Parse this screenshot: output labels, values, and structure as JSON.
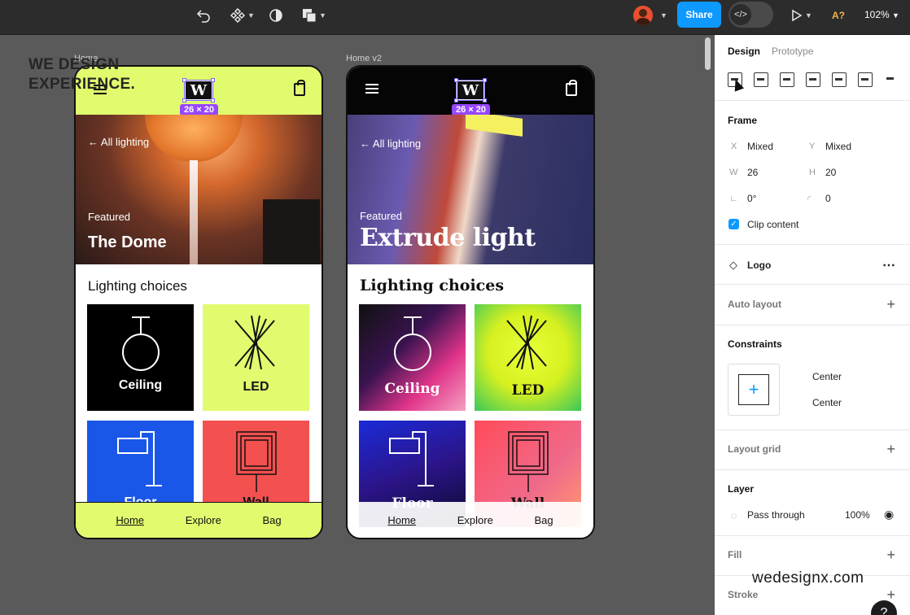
{
  "toolbar": {
    "share_label": "Share",
    "zoom": "102%",
    "a_label": "A?",
    "dev_icon": "</>"
  },
  "canvas": {
    "frame1_label": "Home",
    "frame2_label": "Home v2",
    "watermark_top_line1": "WE DESIGN",
    "watermark_top_line2": "EXPERIENCE.",
    "watermark_bottom": "wedesignx.com"
  },
  "phone1": {
    "size_badge": "26 × 20",
    "back_link": "← All lighting",
    "featured": "Featured",
    "hero_title": "The Dome",
    "section_title": "Lighting choices",
    "tiles": [
      "Ceiling",
      "LED",
      "Floor",
      "Wall"
    ],
    "nav": [
      "Home",
      "Explore",
      "Bag"
    ]
  },
  "phone2": {
    "size_badge": "26 × 20",
    "back_link": "← All lighting",
    "featured": "Featured",
    "hero_title": "Extrude light",
    "section_title": "Lighting choices",
    "tiles": [
      "Ceiling",
      "LED",
      "Floor",
      "Wall"
    ],
    "nav": [
      "Home",
      "Explore",
      "Bag"
    ]
  },
  "panel": {
    "tab_design": "Design",
    "tab_prototype": "Prototype",
    "frame_title": "Frame",
    "x_key": "X",
    "x_val": "Mixed",
    "y_key": "Y",
    "y_val": "Mixed",
    "w_key": "W",
    "w_val": "26",
    "h_key": "H",
    "h_val": "20",
    "rotation": "0°",
    "radius": "0",
    "clip_content": "Clip content",
    "component_name": "Logo",
    "auto_layout": "Auto layout",
    "constraints": "Constraints",
    "constraint_h": "Center",
    "constraint_v": "Center",
    "layout_grid": "Layout grid",
    "layer": "Layer",
    "blend_mode": "Pass through",
    "opacity": "100%",
    "fill": "Fill",
    "stroke": "Stroke"
  },
  "colors": {
    "accent_blue": "#0d99ff",
    "lime": "#e1fb6e",
    "selection_purple": "#9747ff"
  }
}
